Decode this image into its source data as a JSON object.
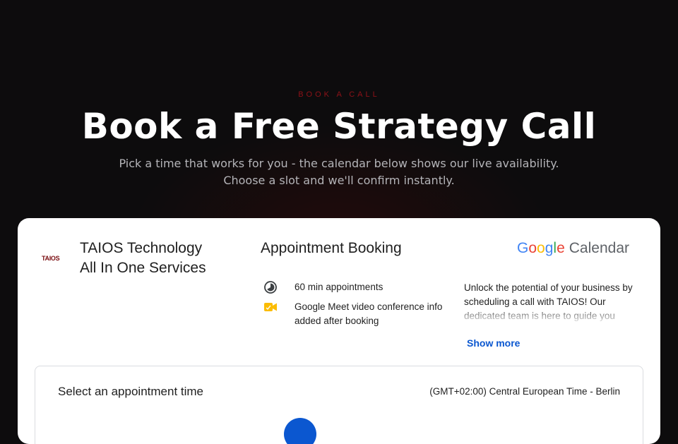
{
  "hero": {
    "eyebrow": "BOOK A CALL",
    "title": "Book a Free Strategy Call",
    "subtitle_line1": "Pick a time that works for you - the calendar below shows our live availability.",
    "subtitle_line2": "Choose a slot and we'll confirm instantly."
  },
  "booking": {
    "logo_text": "TAIOS",
    "org_line1": "TAIOS Technology",
    "org_line2": "All In One Services",
    "title": "Appointment Booking",
    "provider": {
      "g1": "G",
      "g2": "o",
      "g3": "o",
      "g4": "g",
      "g5": "l",
      "g6": "e",
      "product": "Calendar"
    },
    "duration": "60 min appointments",
    "meet_info": "Google Meet video conference info added after booking",
    "description": "Unlock the potential of your business by scheduling a call with TAIOS! Our dedicated team is here to guide you",
    "show_more": "Show more",
    "slots": {
      "title": "Select an appointment time",
      "timezone": "(GMT+02:00) Central European Time - Berlin"
    }
  },
  "colors": {
    "background": "#0d0c0d",
    "accent_red": "#8e1218",
    "link_blue": "#0b57d0",
    "google_blue": "#4285f4",
    "google_red": "#ea4335",
    "google_yellow": "#fbbc05",
    "google_green": "#34a853"
  },
  "icons": {
    "duration": "clock-icon",
    "meet": "video-camera-icon"
  }
}
